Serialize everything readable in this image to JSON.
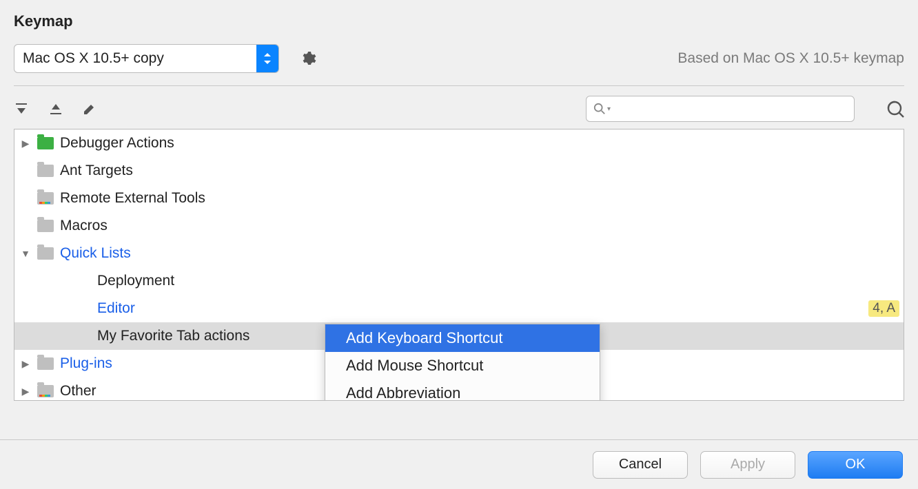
{
  "title": "Keymap",
  "keymap_selector": {
    "value": "Mac OS X 10.5+ copy"
  },
  "based_on": "Based on Mac OS X 10.5+ keymap",
  "tree": {
    "items": [
      {
        "label": "Debugger Actions",
        "icon": "green"
      },
      {
        "label": "Ant Targets",
        "icon": "grey"
      },
      {
        "label": "Remote External Tools",
        "icon": "dots"
      },
      {
        "label": "Macros",
        "icon": "grey"
      },
      {
        "label": "Quick Lists",
        "icon": "grey",
        "link": true
      },
      {
        "label": "Deployment"
      },
      {
        "label": "Editor",
        "shortcut": "4, A",
        "link": true
      },
      {
        "label": "My Favorite Tab actions",
        "selected": true
      },
      {
        "label": "Plug-ins",
        "icon": "grey",
        "link": true
      },
      {
        "label": "Other",
        "icon": "dots"
      }
    ]
  },
  "context_menu": {
    "items": [
      {
        "label": "Add Keyboard Shortcut",
        "highlight": true
      },
      {
        "label": "Add Mouse Shortcut"
      },
      {
        "label": "Add Abbreviation"
      }
    ]
  },
  "buttons": {
    "cancel": "Cancel",
    "apply": "Apply",
    "ok": "OK"
  }
}
